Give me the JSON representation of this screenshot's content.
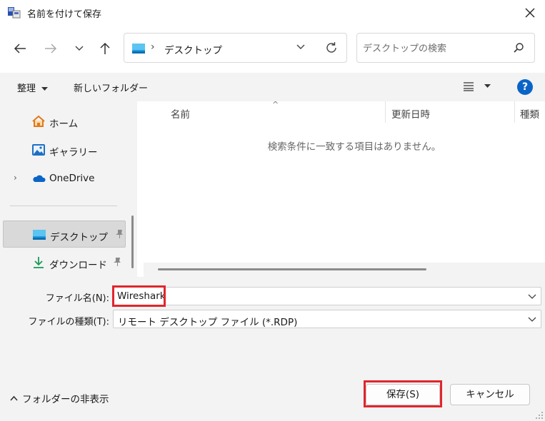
{
  "window": {
    "title": "名前を付けて保存"
  },
  "navbar": {
    "address_path": "デスクトップ",
    "search_placeholder": "デスクトップの検索"
  },
  "commandbar": {
    "organize_label": "整理",
    "new_folder_label": "新しいフォルダー",
    "help_label": "?"
  },
  "nav_pane": {
    "items": [
      {
        "label": "ホーム",
        "icon": "home-icon"
      },
      {
        "label": "ギャラリー",
        "icon": "gallery-icon"
      },
      {
        "label": "OneDrive",
        "icon": "onedrive-icon"
      },
      {
        "label": "デスクトップ",
        "icon": "desktop-folder-icon",
        "selected": true,
        "pinned": true
      },
      {
        "label": "ダウンロード",
        "icon": "download-icon",
        "pinned": true
      }
    ]
  },
  "file_list": {
    "columns": [
      "名前",
      "更新日時",
      "種類"
    ],
    "empty_message": "検索条件に一致する項目はありません。"
  },
  "form": {
    "filename_label": "ファイル名(N):",
    "filename_value": "Wireshark",
    "filetype_label": "ファイルの種類(T):",
    "filetype_value": "リモート デスクトップ ファイル (*.RDP)"
  },
  "footer": {
    "hide_folders_label": "フォルダーの非表示",
    "save_label": "保存(S)",
    "cancel_label": "キャンセル"
  },
  "colors": {
    "accent": "#0a64c8",
    "highlight_box": "#e0262c",
    "panel_bg": "#f3f3f3"
  }
}
